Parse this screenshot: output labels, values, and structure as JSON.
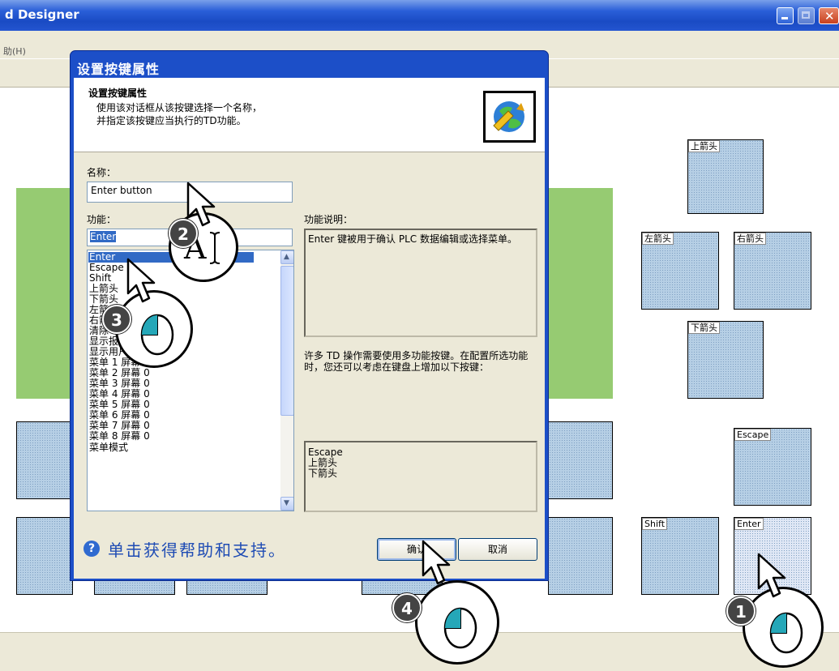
{
  "app": {
    "title": "d Designer",
    "menu_help": "助(H)"
  },
  "keys": {
    "up": "上箭头",
    "left": "左箭头",
    "right": "右箭头",
    "down": "下箭头",
    "escape": "Escape",
    "shift": "Shift",
    "enter": "Enter"
  },
  "dialog": {
    "title": "设置按键属性",
    "header_title": "设置按键属性",
    "header_desc_line1": "使用该对话框从该按键选择一个名称，",
    "header_desc_line2": "并指定该按键应当执行的TD功能。",
    "name_label": "名称：",
    "name_value": "Enter button",
    "function_label": "功能：",
    "function_value": "Enter",
    "function_list": [
      "Enter",
      "Escape",
      "Shift",
      "上箭头",
      "下箭头",
      "左箭头",
      "右箭头",
      "清除",
      "显示报警",
      "显示用户菜单",
      "菜单 1 屏幕 0",
      "菜单 2 屏幕 0",
      "菜单 3 屏幕 0",
      "菜单 4 屏幕 0",
      "菜单 5 屏幕 0",
      "菜单 6 屏幕 0",
      "菜单 7 屏幕 0",
      "菜单 8 屏幕 0",
      "菜单模式"
    ],
    "description_label": "功能说明：",
    "description_text": "Enter 键被用于确认 PLC 数据编辑或选择菜单。",
    "hint_text": "许多 TD 操作需要使用多功能按键。在配置所选功能时，您还可以考虑在键盘上增加以下按键：",
    "suggested_keys": [
      "Escape",
      "上箭头",
      "下箭头"
    ],
    "help_text": "单击获得帮助和支持。",
    "ok_label": "确认",
    "cancel_label": "取消"
  },
  "callouts": [
    "1",
    "2",
    "3",
    "4"
  ],
  "icons": {
    "help": "help-icon",
    "header": "wizard-globe-icon",
    "cursor": "mouse-pointer-icon",
    "text_cursor": "text-cursor-icon",
    "mouse": "mouse-click-icon"
  },
  "colors": {
    "titlebar": "#2a5fd8",
    "selection": "#316ac5",
    "green_block": "#96cb72",
    "key_fill": "#b6cfe5"
  }
}
